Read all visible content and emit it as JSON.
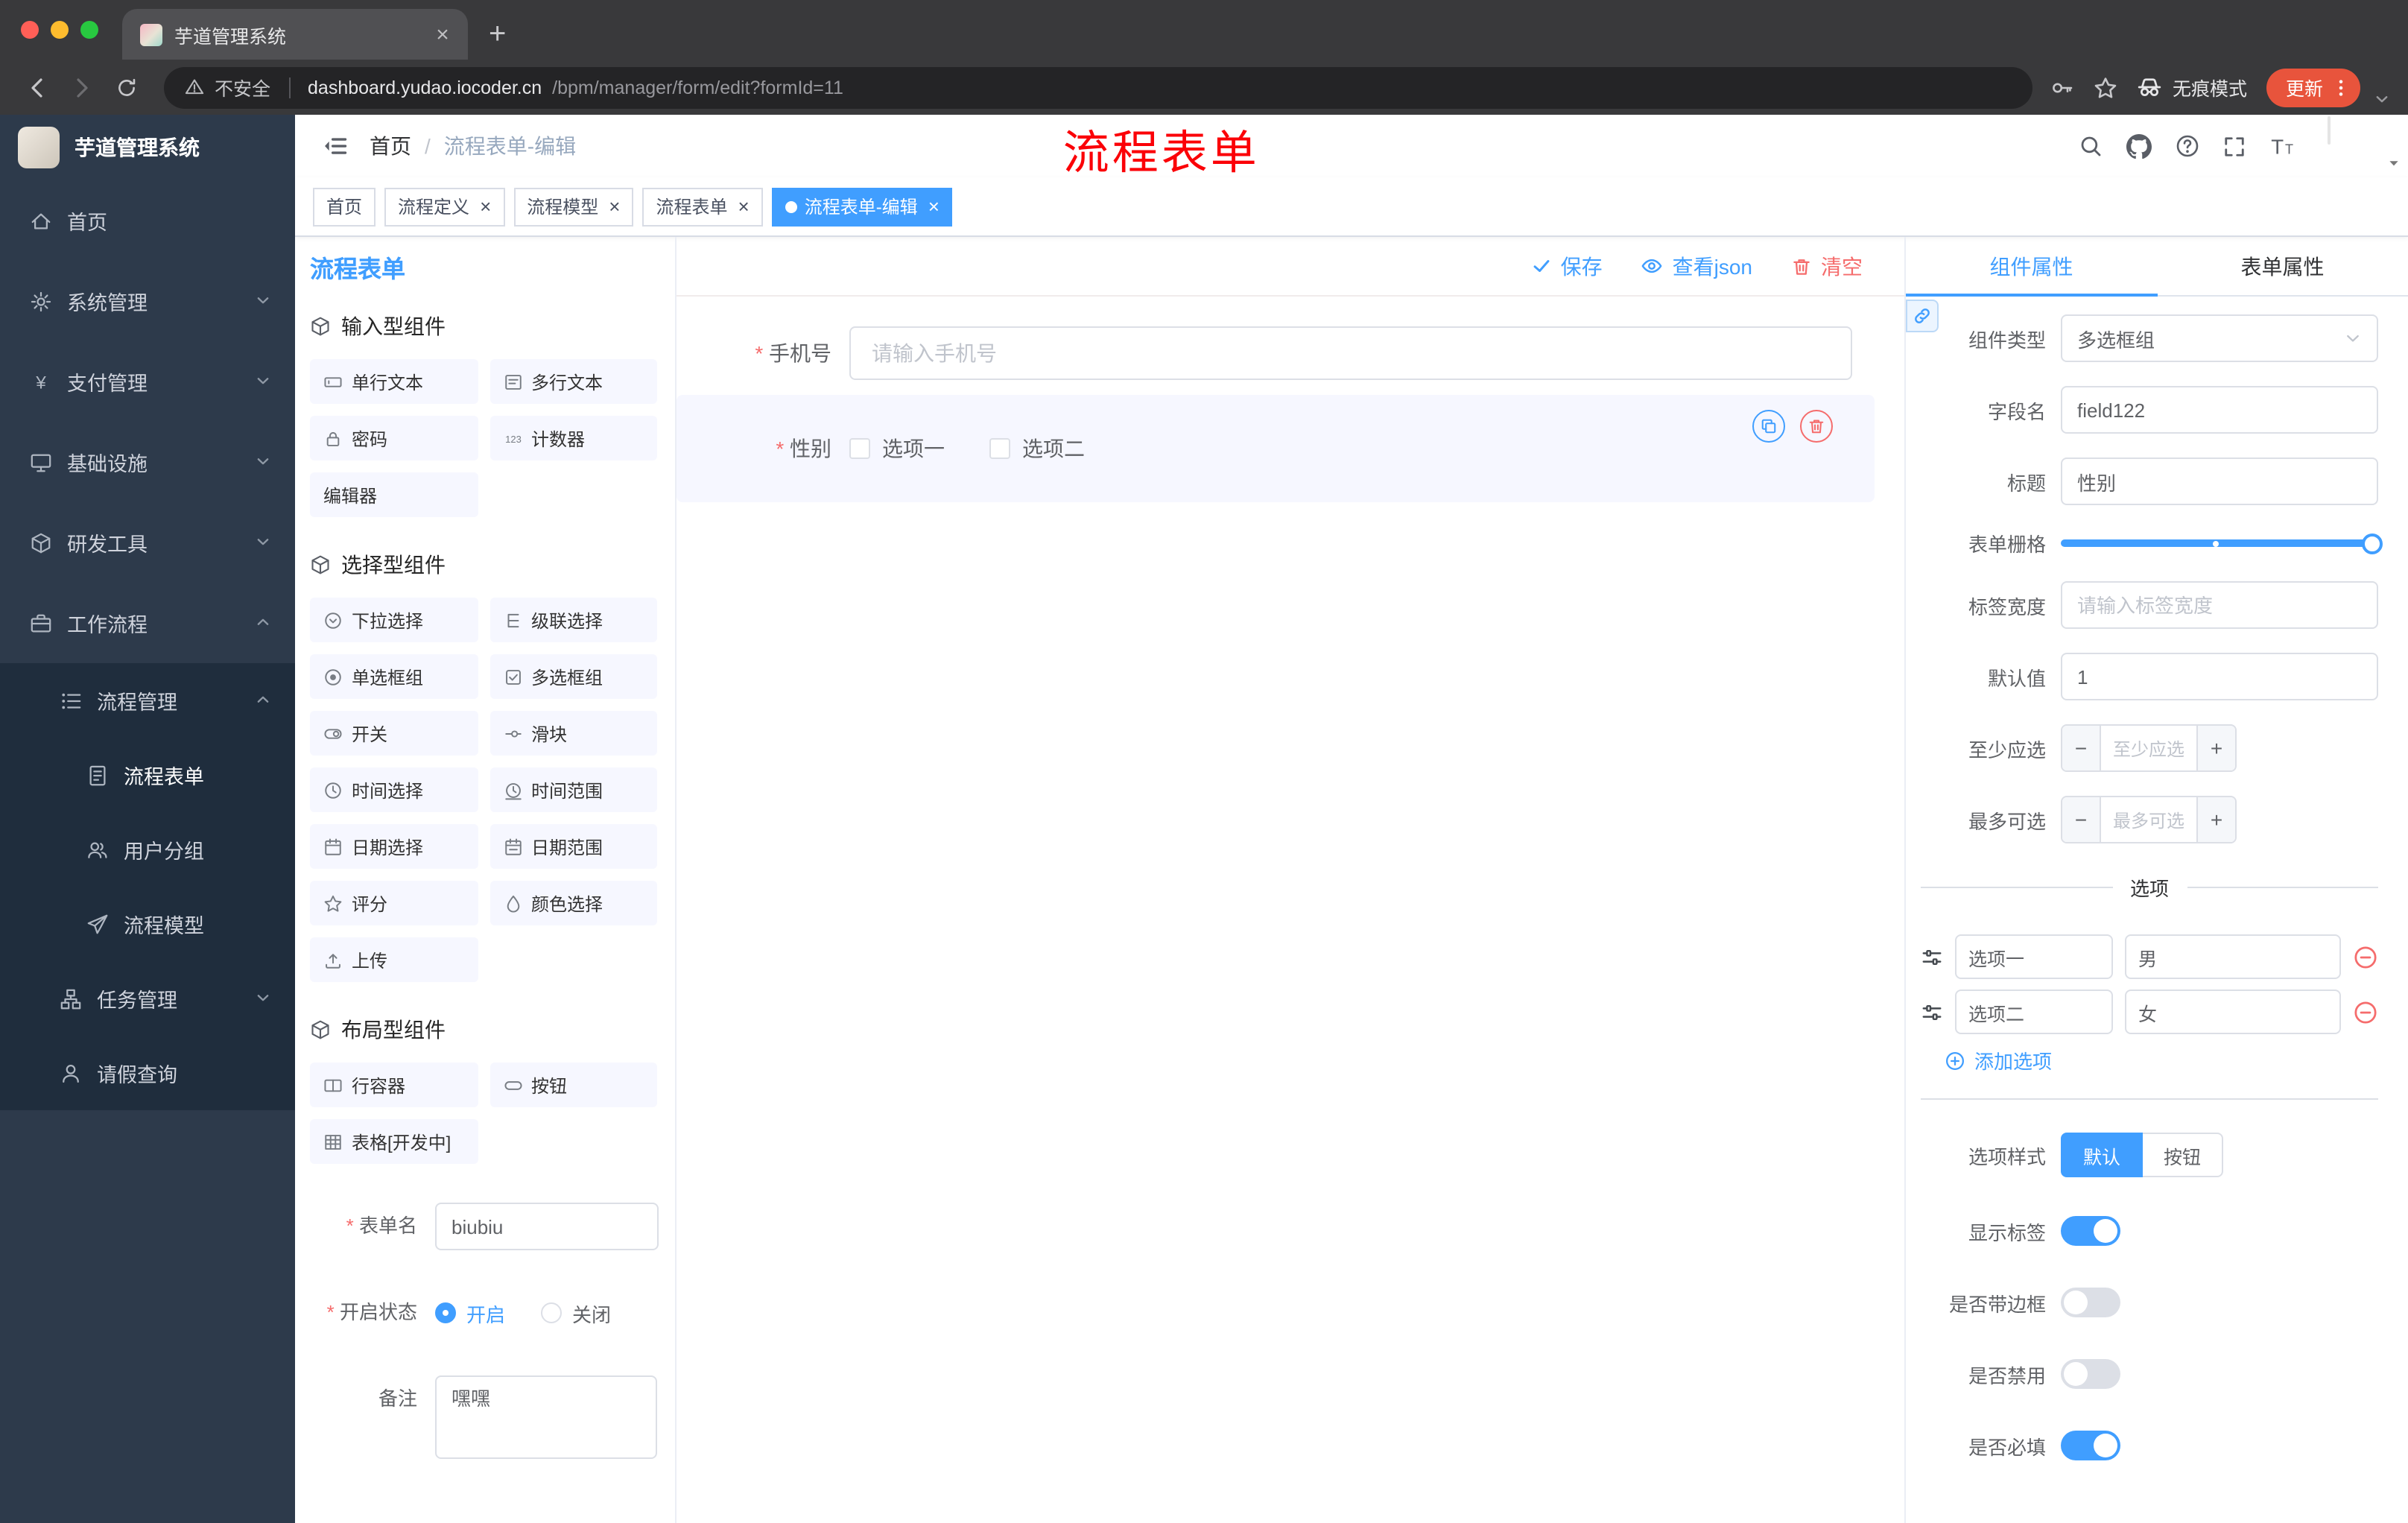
{
  "colors": {
    "accent": "#409eff",
    "danger": "#f56c6c",
    "sidebar_bg": "#2d3a4b",
    "sidebar_sub_bg": "#1f2d3d",
    "chrome_bg": "#39393b",
    "chrome_tab_bg": "#505053",
    "urlbar_bg": "#242426",
    "update_btn": "#e8543c",
    "annotation": "#fb0007"
  },
  "browser": {
    "tab_title": "芋道管理系统",
    "security_label": "不安全",
    "url_host": "dashboard.yudao.iocoder.cn",
    "url_path": "/bpm/manager/form/edit?formId=11",
    "incognito_label": "无痕模式",
    "update_label": "更新"
  },
  "sidebar": {
    "logo_title": "芋道管理系统",
    "items": [
      {
        "id": "home",
        "label": "首页",
        "icon": "home-icon",
        "level": 0
      },
      {
        "id": "system",
        "label": "系统管理",
        "icon": "gear-icon",
        "level": 0,
        "chevron": "down"
      },
      {
        "id": "payment",
        "label": "支付管理",
        "icon": "yen-icon",
        "level": 0,
        "chevron": "down"
      },
      {
        "id": "infra",
        "label": "基础设施",
        "icon": "monitor-icon",
        "level": 0,
        "chevron": "down"
      },
      {
        "id": "devtools",
        "label": "研发工具",
        "icon": "cube-icon",
        "level": 0,
        "chevron": "down"
      },
      {
        "id": "workflow",
        "label": "工作流程",
        "icon": "briefcase-icon",
        "level": 0,
        "chevron": "up"
      },
      {
        "id": "process-manage",
        "label": "流程管理",
        "icon": "list-icon",
        "level": 1,
        "sub": true,
        "chevron": "up"
      },
      {
        "id": "process-form",
        "label": "流程表单",
        "icon": "document-icon",
        "level": 2,
        "sub": true,
        "active": true
      },
      {
        "id": "user-group",
        "label": "用户分组",
        "icon": "users-icon",
        "level": 2,
        "sub": true
      },
      {
        "id": "process-model",
        "label": "流程模型",
        "icon": "send-icon",
        "level": 2,
        "sub": true
      },
      {
        "id": "task-manage",
        "label": "任务管理",
        "icon": "tree-icon",
        "level": 1,
        "sub": true,
        "chevron": "down"
      },
      {
        "id": "leave-query",
        "label": "请假查询",
        "icon": "user-icon",
        "level": 1,
        "sub": true
      }
    ]
  },
  "header": {
    "breadcrumb_home": "首页",
    "breadcrumb_current": "流程表单-编辑",
    "annotation": "流程表单"
  },
  "page_tabs": [
    {
      "id": "home",
      "label": "首页",
      "closable": false,
      "active": false
    },
    {
      "id": "process-definition",
      "label": "流程定义",
      "closable": true,
      "active": false
    },
    {
      "id": "process-model",
      "label": "流程模型",
      "closable": true,
      "active": false
    },
    {
      "id": "process-form",
      "label": "流程表单",
      "closable": true,
      "active": false
    },
    {
      "id": "process-form-edit",
      "label": "流程表单-编辑",
      "closable": true,
      "active": true
    }
  ],
  "designer": {
    "panel_title": "流程表单",
    "actions": {
      "save": "保存",
      "view_json": "查看json",
      "clear": "清空"
    },
    "palette_sections": [
      {
        "id": "input",
        "title": "输入型组件",
        "items": [
          {
            "label": "单行文本",
            "icon": "input-icon"
          },
          {
            "label": "多行文本",
            "icon": "textarea-icon"
          },
          {
            "label": "密码",
            "icon": "lock-icon"
          },
          {
            "label": "计数器",
            "icon": "counter-icon"
          },
          {
            "label": "编辑器",
            "icon": null
          }
        ]
      },
      {
        "id": "select",
        "title": "选择型组件",
        "items": [
          {
            "label": "下拉选择",
            "icon": "select-icon"
          },
          {
            "label": "级联选择",
            "icon": "cascader-icon"
          },
          {
            "label": "单选框组",
            "icon": "radio-icon"
          },
          {
            "label": "多选框组",
            "icon": "checkbox-icon"
          },
          {
            "label": "开关",
            "icon": "switch-icon"
          },
          {
            "label": "滑块",
            "icon": "slider-icon"
          },
          {
            "label": "时间选择",
            "icon": "time-icon"
          },
          {
            "label": "时间范围",
            "icon": "time-range-icon"
          },
          {
            "label": "日期选择",
            "icon": "date-icon"
          },
          {
            "label": "日期范围",
            "icon": "date-range-icon"
          },
          {
            "label": "评分",
            "icon": "star-icon"
          },
          {
            "label": "颜色选择",
            "icon": "color-icon"
          },
          {
            "label": "上传",
            "icon": "upload-icon"
          }
        ]
      },
      {
        "id": "layout",
        "title": "布局型组件",
        "items": [
          {
            "label": "行容器",
            "icon": "row-icon"
          },
          {
            "label": "按钮",
            "icon": "button-icon"
          },
          {
            "label": "表格[开发中]",
            "icon": "table-icon"
          }
        ]
      }
    ],
    "meta": {
      "form_name_label": "表单名",
      "form_name_value": "biubiu",
      "status_label": "开启状态",
      "status_on": "开启",
      "status_off": "关闭",
      "remark_label": "备注",
      "remark_value": "嘿嘿"
    },
    "canvas": {
      "phone_label": "手机号",
      "phone_placeholder": "请输入手机号",
      "gender_label": "性别",
      "gender_options": [
        "选项一",
        "选项二"
      ]
    }
  },
  "props": {
    "tab_component": "组件属性",
    "tab_form": "表单属性",
    "component_type_label": "组件类型",
    "component_type_value": "多选框组",
    "field_name_label": "字段名",
    "field_name_value": "field122",
    "title_label": "标题",
    "title_value": "性别",
    "grid_label": "表单栅格",
    "label_width_label": "标签宽度",
    "label_width_placeholder": "请输入标签宽度",
    "default_label": "默认值",
    "default_value": "1",
    "min_label": "至少应选",
    "min_placeholder": "至少应选",
    "max_label": "最多可选",
    "max_placeholder": "最多可选",
    "options_title": "选项",
    "options": [
      {
        "label": "选项一",
        "value": "男"
      },
      {
        "label": "选项二",
        "value": "女"
      }
    ],
    "add_option": "添加选项",
    "style_label": "选项样式",
    "style_options": [
      "默认",
      "按钮"
    ],
    "switches": [
      {
        "id": "show-label",
        "label": "显示标签",
        "on": true
      },
      {
        "id": "border",
        "label": "是否带边框",
        "on": false
      },
      {
        "id": "disabled",
        "label": "是否禁用",
        "on": false
      },
      {
        "id": "required",
        "label": "是否必填",
        "on": true
      }
    ]
  }
}
